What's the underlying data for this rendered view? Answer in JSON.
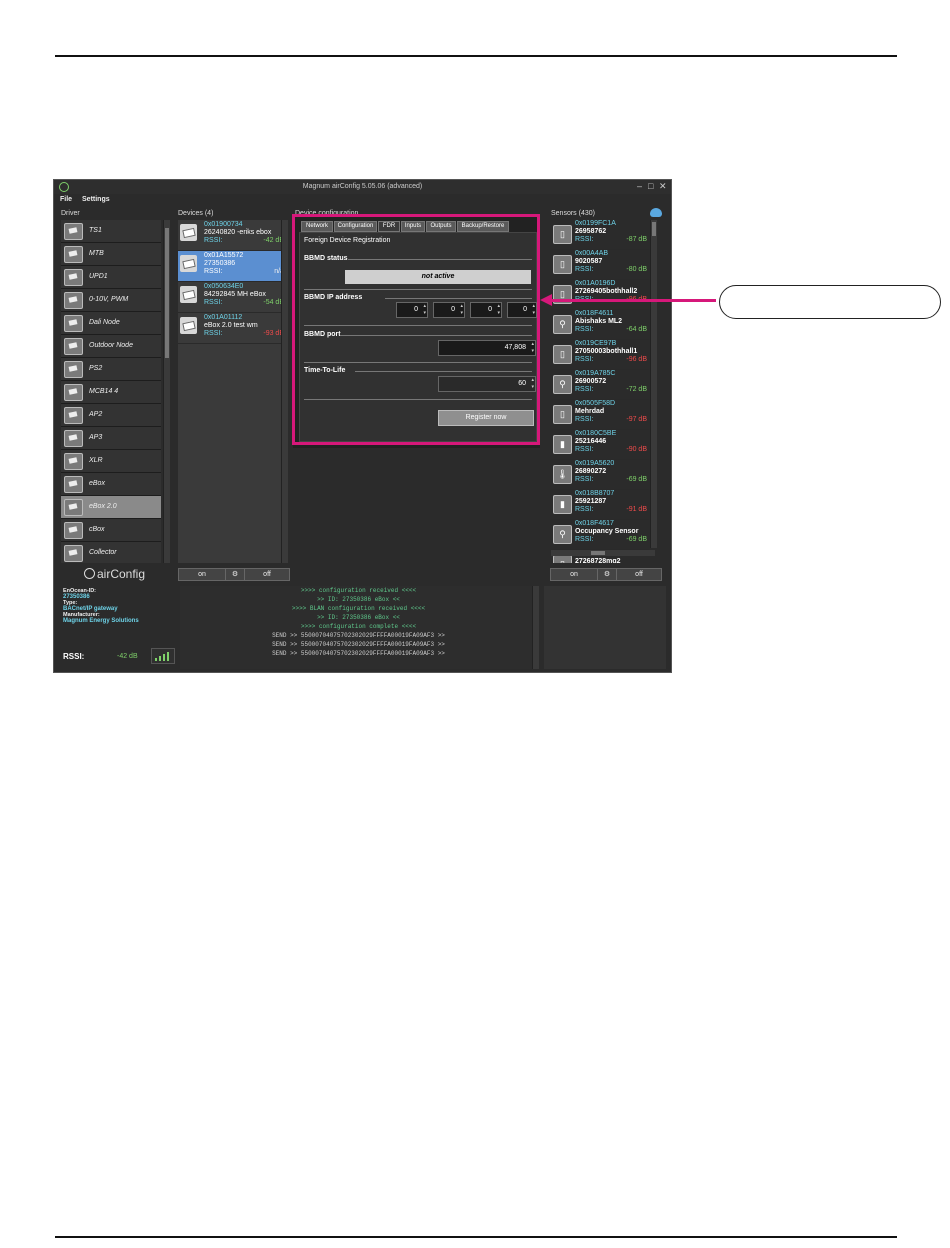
{
  "window": {
    "title": "Magnum airConfig 5.05.06 (advanced)",
    "minimize": "–",
    "maximize": "□",
    "close": "✕"
  },
  "menu": [
    "File",
    "Settings"
  ],
  "panels": {
    "driver": "Driver",
    "devices": "Devices (4)",
    "device_config": "Device configuration",
    "sensors": "Sensors (430)"
  },
  "drivers": [
    {
      "label": "TS1",
      "icon": "module-icon"
    },
    {
      "label": "MTB",
      "icon": "module-icon"
    },
    {
      "label": "UPD1",
      "icon": "module-icon"
    },
    {
      "label": "0-10V, PWM",
      "icon": "module-icon"
    },
    {
      "label": "Dali Node",
      "icon": "module-icon"
    },
    {
      "label": "Outdoor Node",
      "icon": "module-icon"
    },
    {
      "label": "PS2",
      "icon": "module-icon"
    },
    {
      "label": "MCB14 4",
      "icon": "module-icon"
    },
    {
      "label": "AP2",
      "icon": "module-icon"
    },
    {
      "label": "AP3",
      "icon": "module-icon"
    },
    {
      "label": "XLR",
      "icon": "module-icon"
    },
    {
      "label": "eBox",
      "icon": "module-icon"
    },
    {
      "label": "eBox 2.0",
      "icon": "module-icon",
      "selected": true
    },
    {
      "label": "cBox",
      "icon": "module-icon"
    },
    {
      "label": "Collector",
      "icon": "module-icon"
    }
  ],
  "devices": [
    {
      "id": "0x01900734",
      "name": "26240820 -eriks ebox",
      "rssi_label": "RSSI:",
      "rssi": "-42 dB",
      "state": "good"
    },
    {
      "id": "0x01A15572",
      "name": "27350386",
      "rssi_label": "RSSI:",
      "rssi": "n/a",
      "state": "na",
      "selected": true
    },
    {
      "id": "0x050634E0",
      "name": "84292845 MH eBox",
      "rssi_label": "RSSI:",
      "rssi": "-54 dB",
      "state": "good"
    },
    {
      "id": "0x01A01112",
      "name": "eBox 2.0 test wm",
      "rssi_label": "RSSI:",
      "rssi": "-93 dB",
      "state": "bad"
    }
  ],
  "device_buttons": {
    "on": "on",
    "settings": "⚙",
    "off": "off"
  },
  "config_tabs": [
    "Network",
    "Configuration",
    "FDR",
    "Inputs",
    "Outputs",
    "Backup/Restore"
  ],
  "active_tab": "FDR",
  "fdr": {
    "heading": "Foreign Device Registration",
    "bbmd_status_label": "BBMD status",
    "bbmd_status": "not active",
    "bbmd_ip_label": "BBMD IP address",
    "ip": [
      "0",
      "0",
      "0",
      "0"
    ],
    "bbmd_port_label": "BBMD port",
    "bbmd_port": "47,808",
    "ttl_label": "Time-To-Life",
    "ttl": "60",
    "register_button": "Register now"
  },
  "sensors": [
    {
      "id": "0x0199FC1A",
      "name": "26958762",
      "rssi_label": "RSSI:",
      "rssi": "-87 dB",
      "state": "good",
      "icon": "sensor-icon"
    },
    {
      "id": "0x00A4AB",
      "name": "9020587",
      "rssi_label": "RSSI:",
      "rssi": "-80 dB",
      "state": "good",
      "icon": "sensor-icon"
    },
    {
      "id": "0x01A0196D",
      "name": "27269405bothhall2",
      "rssi_label": "RSSI:",
      "rssi": "-96 dB",
      "state": "bad",
      "icon": "sensor-icon"
    },
    {
      "id": "0x018F4611",
      "name": "Abishaks ML2",
      "rssi_label": "RSSI:",
      "rssi": "-64 dB",
      "state": "good",
      "icon": "occupancy-icon"
    },
    {
      "id": "0x019CE97B",
      "name": "27050003bothhall1",
      "rssi_label": "RSSI:",
      "rssi": "-96 dB",
      "state": "bad",
      "icon": "sensor-icon"
    },
    {
      "id": "0x019A785C",
      "name": "26900572",
      "rssi_label": "RSSI:",
      "rssi": "-72 dB",
      "state": "good",
      "icon": "occupancy-icon"
    },
    {
      "id": "0x0505F58D",
      "name": "Mehrdad",
      "rssi_label": "RSSI:",
      "rssi": "-97 dB",
      "state": "bad",
      "icon": "sensor-icon"
    },
    {
      "id": "0x0180C5BE",
      "name": "25216446",
      "rssi_label": "RSSI:",
      "rssi": "-90 dB",
      "state": "bad",
      "icon": "contact-icon"
    },
    {
      "id": "0x019A5620",
      "name": "26890272",
      "rssi_label": "RSSI:",
      "rssi": "-69 dB",
      "state": "good",
      "icon": "thermometer-icon"
    },
    {
      "id": "0x018B8707",
      "name": "25921287",
      "rssi_label": "RSSI:",
      "rssi": "-91 dB",
      "state": "bad",
      "icon": "contact-icon"
    },
    {
      "id": "0x018F4617",
      "name": "Occupancy Sensor",
      "rssi_label": "RSSI:",
      "rssi": "-69 dB",
      "state": "good",
      "icon": "occupancy-icon"
    },
    {
      "id": "0x01A01678",
      "name": "27268728mg2",
      "rssi_label": "",
      "rssi": "",
      "state": "good",
      "icon": "sensor-icon"
    }
  ],
  "brand": "airConfig",
  "info": {
    "enocean_label": "EnOcean-ID:",
    "enocean_id": "27350386",
    "type_label": "Type:",
    "type": "BACnet/IP gateway",
    "manufacturer_label": "Manufacturer:",
    "manufacturer": "Magnum Energy Solutions",
    "rssi_label": "RSSI:",
    "rssi_value": "-42 dB",
    "signal_level": 1.0
  },
  "log": [
    {
      "text": ">>>> configuration received <<<<",
      "kind": "sys"
    },
    {
      "text": ">> ID: 27350386 eBox <<",
      "kind": "sys"
    },
    {
      "text": ">>>> BLAN configuration received <<<<",
      "kind": "sys"
    },
    {
      "text": ">> ID: 27350386 eBox <<",
      "kind": "sys"
    },
    {
      "text": ">>>> configuration complete <<<<",
      "kind": "sys"
    },
    {
      "text": "SEND >> 55000704075702302029FFFFA00019FA09AF3 >>",
      "kind": "send"
    },
    {
      "text": "SEND >> 55000704075702302029FFFFA00019FA09AF3 >>",
      "kind": "send"
    },
    {
      "text": "SEND >> 55000704075702302029FFFFA00019FA09AF3 >>",
      "kind": "send"
    }
  ],
  "colors": {
    "highlight": "#d6187a",
    "accent": "#6ed3e8",
    "good": "#7fd16a",
    "bad": "#ef4b4b"
  }
}
